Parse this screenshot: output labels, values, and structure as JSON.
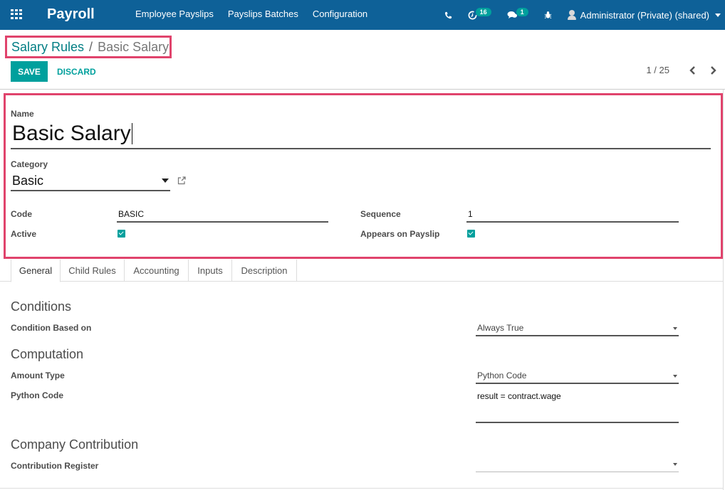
{
  "navbar": {
    "app_name": "Payroll",
    "menu": [
      "Employee Payslips",
      "Payslips Batches",
      "Configuration"
    ],
    "systray": {
      "phone_icon": "phone-icon",
      "activity_icon": "clock-icon",
      "activity_count": "16",
      "messages_icon": "chat-icon",
      "messages_count": "1",
      "debug_icon": "bug-icon",
      "user": "Administrator (Private) (shared)"
    },
    "colors": {
      "bar": "#0e6198",
      "badge": "#00a09d"
    }
  },
  "breadcrumb": {
    "parent": "Salary Rules",
    "separator": "/",
    "current": "Basic Salary"
  },
  "control_panel": {
    "save_label": "SAVE",
    "discard_label": "DISCARD",
    "pager_value": "1 / 25",
    "prev_icon": "‹",
    "next_icon": "›"
  },
  "form": {
    "name_label": "Name",
    "name_value": "Basic Salary",
    "category_label": "Category",
    "category_value": "Basic",
    "code_label": "Code",
    "code_value": "BASIC",
    "active_label": "Active",
    "active_checked": true,
    "sequence_label": "Sequence",
    "sequence_value": "1",
    "appears_label": "Appears on Payslip",
    "appears_checked": true,
    "highlight_color": "#e0436c",
    "accent_color": "#00a09d"
  },
  "tabs": [
    {
      "label": "General",
      "active": true
    },
    {
      "label": "Child Rules",
      "active": false
    },
    {
      "label": "Accounting",
      "active": false
    },
    {
      "label": "Inputs",
      "active": false
    },
    {
      "label": "Description",
      "active": false
    }
  ],
  "general": {
    "conditions_title": "Conditions",
    "condition_based_label": "Condition Based on",
    "condition_based_value": "Always True",
    "computation_title": "Computation",
    "amount_type_label": "Amount Type",
    "amount_type_value": "Python Code",
    "python_code_label": "Python Code",
    "python_code_value": "result = contract.wage",
    "company_contribution_title": "Company Contribution",
    "contribution_register_label": "Contribution Register",
    "contribution_register_value": ""
  }
}
